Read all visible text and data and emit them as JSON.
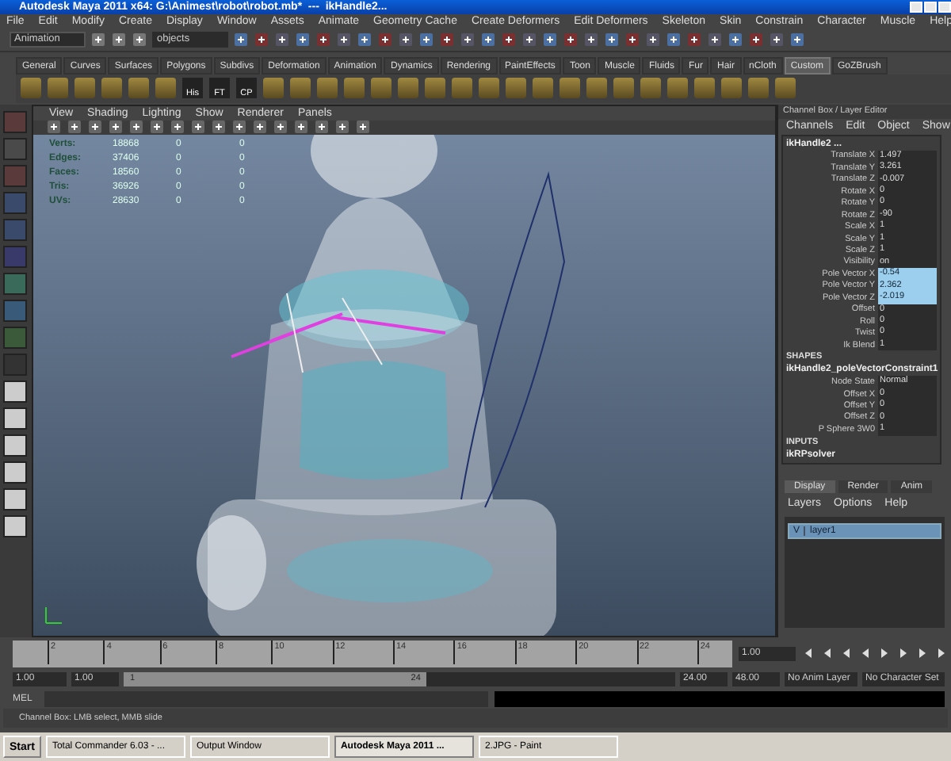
{
  "window": {
    "title": "Autodesk Maya 2011 x64: G:\\Animest\\robot\\robot.mb*  ---  ikHandle2..."
  },
  "menu": [
    "File",
    "Edit",
    "Modify",
    "Create",
    "Display",
    "Window",
    "Assets",
    "Animate",
    "Geometry Cache",
    "Create Deformers",
    "Edit Deformers",
    "Skeleton",
    "Skin",
    "Constrain",
    "Character",
    "Muscle",
    "Help"
  ],
  "status_line": {
    "mode": "Animation",
    "object_field": "objects"
  },
  "shelf": {
    "tabs": [
      {
        "label": "General",
        "selected": false
      },
      {
        "label": "Curves",
        "selected": false
      },
      {
        "label": "Surfaces",
        "selected": false
      },
      {
        "label": "Polygons",
        "selected": false
      },
      {
        "label": "Subdivs",
        "selected": false
      },
      {
        "label": "Deformation",
        "selected": false
      },
      {
        "label": "Animation",
        "selected": false
      },
      {
        "label": "Dynamics",
        "selected": false
      },
      {
        "label": "Rendering",
        "selected": false
      },
      {
        "label": "PaintEffects",
        "selected": false
      },
      {
        "label": "Toon",
        "selected": false
      },
      {
        "label": "Muscle",
        "selected": false
      },
      {
        "label": "Fluids",
        "selected": false
      },
      {
        "label": "Fur",
        "selected": false
      },
      {
        "label": "Hair",
        "selected": false
      },
      {
        "label": "nCloth",
        "selected": false
      },
      {
        "label": "Custom",
        "selected": true
      },
      {
        "label": "GoZBrush",
        "selected": false
      }
    ],
    "icon_labels": [
      "His",
      "FT",
      "CP"
    ]
  },
  "viewport": {
    "menu": [
      "View",
      "Shading",
      "Lighting",
      "Show",
      "Renderer",
      "Panels"
    ],
    "hud": [
      {
        "label": "Verts:",
        "values": [
          "18868",
          "0",
          "0"
        ]
      },
      {
        "label": "Edges:",
        "values": [
          "37406",
          "0",
          "0"
        ]
      },
      {
        "label": "Faces:",
        "values": [
          "18560",
          "0",
          "0"
        ]
      },
      {
        "label": "Tris:",
        "values": [
          "36926",
          "0",
          "0"
        ]
      },
      {
        "label": "UVs:",
        "values": [
          "28630",
          "0",
          "0"
        ]
      }
    ]
  },
  "channel_box": {
    "title": "Channel Box / Layer Editor",
    "menu": [
      "Channels",
      "Edit",
      "Object",
      "Show"
    ],
    "node": "ikHandle2 ...",
    "channels": [
      {
        "label": "Translate X",
        "value": "1.497",
        "selected": false
      },
      {
        "label": "Translate Y",
        "value": "3.261",
        "selected": false
      },
      {
        "label": "Translate Z",
        "value": "-0.007",
        "selected": false
      },
      {
        "label": "Rotate X",
        "value": "0",
        "selected": false
      },
      {
        "label": "Rotate Y",
        "value": "0",
        "selected": false
      },
      {
        "label": "Rotate Z",
        "value": "-90",
        "selected": false
      },
      {
        "label": "Scale X",
        "value": "1",
        "selected": false
      },
      {
        "label": "Scale Y",
        "value": "1",
        "selected": false
      },
      {
        "label": "Scale Z",
        "value": "1",
        "selected": false
      },
      {
        "label": "Visibility",
        "value": "on",
        "selected": false
      },
      {
        "label": "Pole Vector X",
        "value": "-0.54",
        "selected": true
      },
      {
        "label": "Pole Vector Y",
        "value": "2.362",
        "selected": true
      },
      {
        "label": "Pole Vector Z",
        "value": "-2.019",
        "selected": true
      },
      {
        "label": "Offset",
        "value": "0",
        "selected": false
      },
      {
        "label": "Roll",
        "value": "0",
        "selected": false
      },
      {
        "label": "Twist",
        "value": "0",
        "selected": false
      },
      {
        "label": "Ik Blend",
        "value": "1",
        "selected": false
      }
    ],
    "shapes_heading": "SHAPES",
    "shape_node": "ikHandle2_poleVectorConstraint1",
    "shape_channels": [
      {
        "label": "Node State",
        "value": "Normal",
        "selected": false
      },
      {
        "label": "Offset X",
        "value": "0",
        "selected": false
      },
      {
        "label": "Offset Y",
        "value": "0",
        "selected": false
      },
      {
        "label": "Offset Z",
        "value": "0",
        "selected": false
      },
      {
        "label": "P Sphere 3W0",
        "value": "1",
        "selected": false
      }
    ],
    "inputs_heading": "INPUTS",
    "input_node": "ikRPsolver"
  },
  "layer_editor": {
    "tabs": [
      {
        "label": "Display",
        "selected": true
      },
      {
        "label": "Render",
        "selected": false
      },
      {
        "label": "Anim",
        "selected": false
      }
    ],
    "menu": [
      "Layers",
      "Options",
      "Help"
    ],
    "layers": [
      {
        "visibility": "V",
        "name": "layer1",
        "selected": true
      }
    ]
  },
  "time_slider": {
    "ticks": [
      "2",
      "4",
      "6",
      "8",
      "10",
      "12",
      "14",
      "16",
      "18",
      "20",
      "22",
      "24"
    ],
    "current_frame": "1.00"
  },
  "range_slider": {
    "start": "1.00",
    "playback_start": "1.00",
    "range_start": "1",
    "range_end": "24",
    "playback_end": "24.00",
    "end": "48.00",
    "anim_layer": "No Anim Layer",
    "character_set": "No Character Set"
  },
  "command_line": {
    "label": "MEL"
  },
  "help_line": "Channel Box: LMB select, MMB slide",
  "taskbar": {
    "start": "Start",
    "items": [
      {
        "label": "Total Commander 6.03 - ...",
        "selected": false
      },
      {
        "label": "Output Window",
        "selected": false
      },
      {
        "label": "Autodesk Maya 2011 ...",
        "selected": true
      },
      {
        "label": "2.JPG - Paint",
        "selected": false
      }
    ]
  }
}
